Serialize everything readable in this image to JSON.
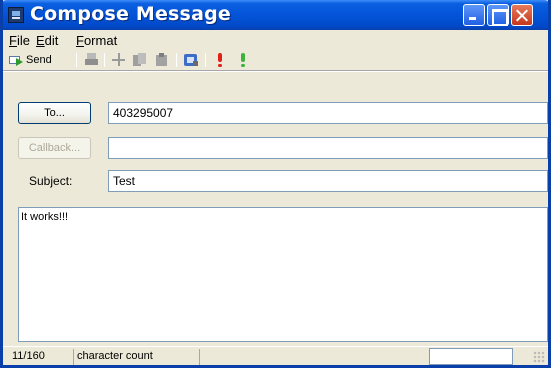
{
  "window": {
    "title": "Compose Message"
  },
  "menu": {
    "file": {
      "accel": "F",
      "rest": "ile"
    },
    "edit": {
      "accel": "E",
      "rest": "dit"
    },
    "format": {
      "accel": "F",
      "rest": "ormat"
    }
  },
  "toolbar": {
    "send_label": "Send",
    "icons": [
      "send-icon",
      "print-icon",
      "cut-icon",
      "copy-icon",
      "paste-icon",
      "address-book-icon",
      "high-priority-icon",
      "low-priority-icon"
    ],
    "colors": {
      "high_priority": "#e0201a",
      "low_priority": "#3cb43c"
    }
  },
  "form": {
    "to_button_label": "To...",
    "to_value": "403295007",
    "callback_button_label": "Callback...",
    "callback_value": "",
    "subject_label": "Subject:",
    "subject_value": "Test",
    "message_body": "It works!!!"
  },
  "status": {
    "count": "11/160",
    "count_label": "character count"
  },
  "theme": {
    "titlebar_blue": "#0454d8",
    "window_face": "#ece9d8"
  }
}
